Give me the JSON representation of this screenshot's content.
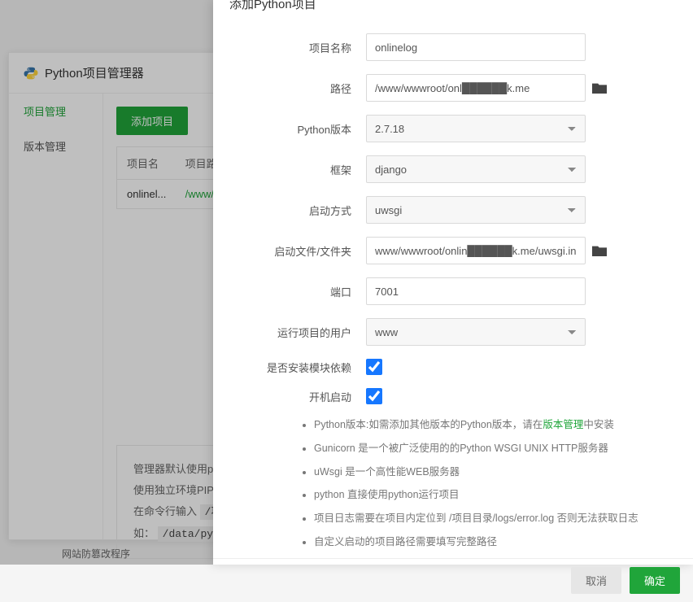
{
  "manager": {
    "title": "Python项目管理器",
    "sidebar": {
      "project": "项目管理",
      "version": "版本管理"
    },
    "add_button": "添加项目",
    "table": {
      "col_name": "项目名",
      "col_path": "项目路径",
      "row0_name": "onlinel...",
      "row0_path": "/www/w"
    },
    "tip": {
      "line1_pre": "管理器默认使用pip",
      "line2_pre": "使用独立环境PIP的",
      "line3_pre": "在命令行输入",
      "line3_code": "/项",
      "line4_pre": "如：",
      "line4_code": "/data/python"
    }
  },
  "lower_label": "网站防篡改程序",
  "modal": {
    "title": "添加Python项目",
    "labels": {
      "name": "项目名称",
      "path": "路径",
      "pyver": "Python版本",
      "framework": "框架",
      "startmode": "启动方式",
      "startfile": "启动文件/文件夹",
      "port": "端口",
      "runuser": "运行项目的用户",
      "installdep": "是否安装模块依赖",
      "autostart": "开机启动"
    },
    "values": {
      "name": "onlinelog",
      "path": "/www/wwwroot/onl██████k.me",
      "pyver": "2.7.18",
      "framework": "django",
      "startmode": "uwsgi",
      "startfile": "www/wwwroot/onlin██████k.me/uwsgi.ini",
      "port": "7001",
      "runuser": "www"
    },
    "bullets": {
      "b1_pre": "Python版本:如需添加其他版本的Python版本，请在",
      "b1_link": "版本管理",
      "b1_post": "中安装",
      "b2": "Gunicorn 是一个被广泛使用的的Python WSGI UNIX HTTP服务器",
      "b3": "uWsgi 是一个高性能WEB服务器",
      "b4": "python 直接使用python运行项目",
      "b5": "项目日志需要在项目内定位到 /项目目录/logs/error.log 否则无法获取日志",
      "b6": "自定义启动的项目路径需要填写完整路径"
    },
    "footer": {
      "cancel": "取消",
      "ok": "确定"
    }
  }
}
